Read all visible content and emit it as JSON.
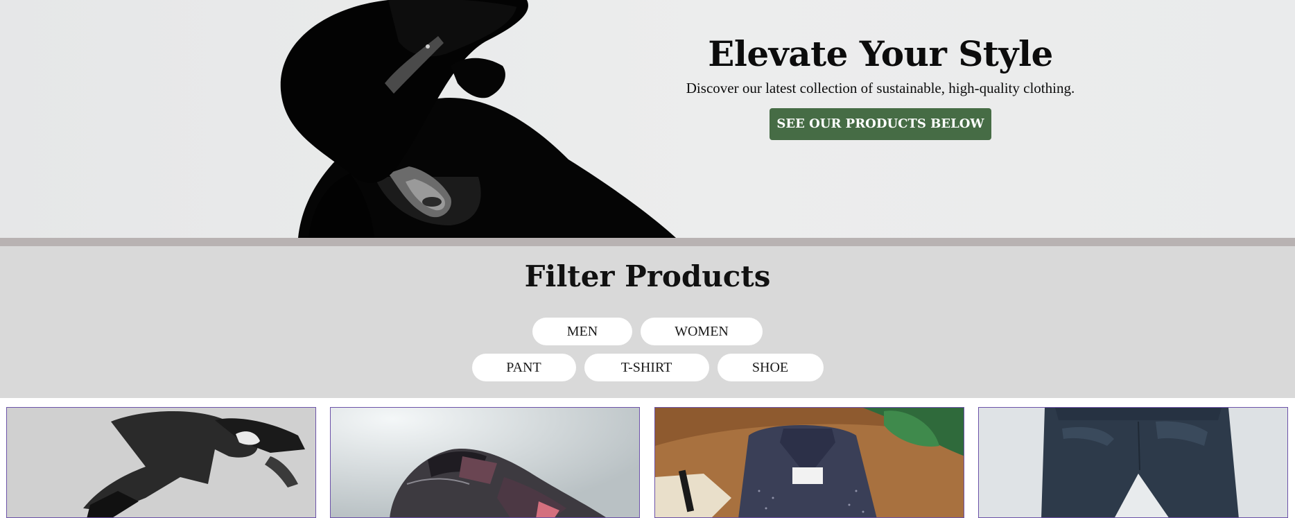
{
  "hero": {
    "title": "Elevate Your Style",
    "subtitle": "Discover our latest collection of sustainable, high-quality clothing.",
    "cta_label": "SEE OUR PRODUCTS BELOW",
    "cta_color": "#466c45",
    "image": "woman-in-black-hat-photo"
  },
  "filter": {
    "title": "Filter Products",
    "categories": [
      "MEN",
      "WOMEN"
    ],
    "types": [
      "PANT",
      "T-SHIRT",
      "SHOE"
    ]
  },
  "products": [
    {
      "image": "man-jumping-photo"
    },
    {
      "image": "sneaker-photo"
    },
    {
      "image": "folded-shirt-photo"
    },
    {
      "image": "pants-photo"
    }
  ],
  "colors": {
    "accent": "#466c45",
    "filter_bg": "#d9d9d9",
    "divider": "#b8b2b2",
    "card_border": "#6b52a8"
  }
}
